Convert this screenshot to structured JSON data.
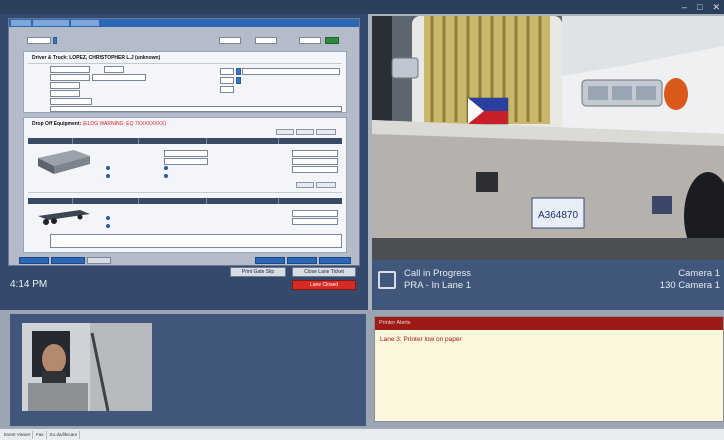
{
  "window": {
    "controls": [
      "–",
      "□",
      "✕"
    ]
  },
  "form": {
    "driver_title": "Driver & Truck: LOPEZ, CHRISTOPHER L.J (unknown)",
    "equipment_title": "Drop Off Equipment:",
    "equipment_warning": "(ELOG WARNING: EQ 7XXXXXXXX)",
    "notes_value": ""
  },
  "clock": {
    "time": "4:14 PM"
  },
  "actions": {
    "btn1": "Print Gate Slip",
    "btn2": "Close Lane Ticket",
    "btn3": "Lane Closed"
  },
  "call": {
    "line1": "Call in Progress",
    "line2": "PRA - In Lane 1",
    "cam1": "Camera 1",
    "cam2": "130 Camera 1"
  },
  "camera": {
    "plate": "A364870"
  },
  "alerts": {
    "header": "Printer Alerts",
    "message": "Lane 3: Printer low on paper"
  },
  "taskbar": {
    "items": [
      "Event Viewer",
      "Fax",
      "Ex.da/lifecare"
    ]
  },
  "colors": {
    "app_blue": "#40567a",
    "alert_red": "#9d1a17",
    "alert_bg": "#fbf6dc",
    "accent_blue": "#2c67b5"
  }
}
